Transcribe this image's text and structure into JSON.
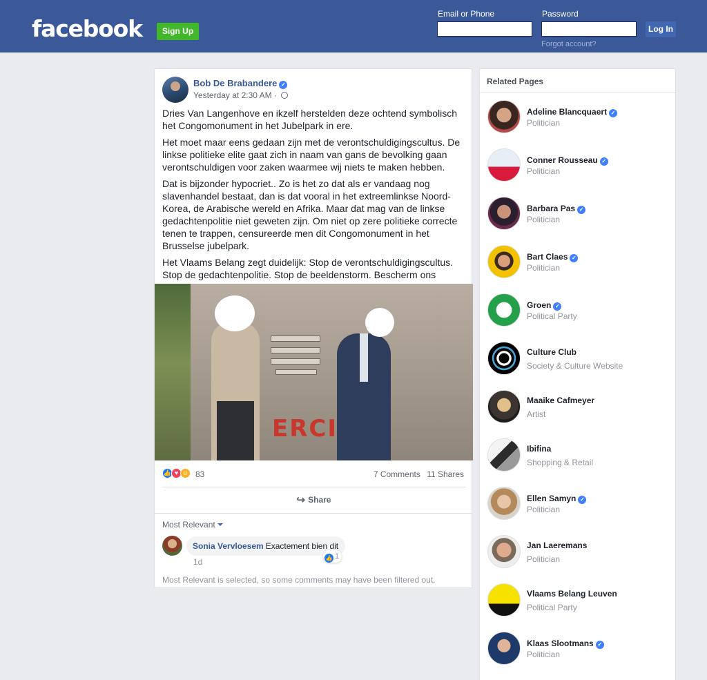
{
  "header": {
    "logo": "facebook",
    "signup_label": "Sign Up",
    "email_label": "Email or Phone",
    "password_label": "Password",
    "login_label": "Log In",
    "forgot_label": "Forgot account?",
    "brand_color": "#3b5998"
  },
  "post": {
    "author": "Bob De Brabandere",
    "timestamp": "Yesterday at 2:30 AM",
    "paragraphs": [
      "Dries Van Langenhove en ikzelf herstelden deze ochtend symbolisch het Congomonument in het Jubelpark in ere.",
      "Het moet maar eens gedaan zijn met de verontschuldigingscultus. De linkse politieke elite gaat zich in naam van gans de bevolking gaan verontschuldigen voor zaken waarmee wij niets te maken hebben.",
      "Dat is bijzonder hypocriet.. Zo is het zo dat als er vandaag nog slavenhandel bestaat, dan is dat vooral in het extreemlinkse Noord-Korea, de Arabische wereld en Afrika. Maar dat mag van de linkse gedachtenpolitie niet geweten zijn. Om niet op zere politieke correcte tenen te trappen, censureerde men dit Congomonument in het Brusselse jubelpark.",
      "Het Vlaams Belang zegt duidelijk: Stop de verontschuldigingscultus. Stop de gedachtenpolitie. Stop de beeldenstorm. Bescherm ons erfgoed!"
    ],
    "photo_graffiti": "ERCI",
    "reaction_count": "83",
    "comments_count": "7 Comments",
    "shares_count": "11 Shares",
    "share_label": "Share",
    "sort_label": "Most Relevant",
    "comment": {
      "author": "Sonia Vervloesem",
      "text": "Exactement bien dit",
      "likes": "1",
      "time": "1d"
    },
    "filter_note": "Most Relevant is selected, so some comments may have been filtered out."
  },
  "related": {
    "title": "Related Pages",
    "pages": [
      {
        "name": "Adeline Blancquaert",
        "category": "Politician",
        "verified": true
      },
      {
        "name": "Conner Rousseau",
        "category": "Politician",
        "verified": true
      },
      {
        "name": "Barbara Pas",
        "category": "Politician",
        "verified": true
      },
      {
        "name": "Bart Claes",
        "category": "Politician",
        "verified": true
      },
      {
        "name": "Groen",
        "category": "Political Party",
        "verified": true
      },
      {
        "name": "Culture Club",
        "category": "Society & Culture Website",
        "verified": false
      },
      {
        "name": "Maaike Cafmeyer",
        "category": "Artist",
        "verified": false
      },
      {
        "name": "Ibifina",
        "category": "Shopping & Retail",
        "verified": false
      },
      {
        "name": "Ellen Samyn",
        "category": "Politician",
        "verified": true
      },
      {
        "name": "Jan Laeremans",
        "category": "Politician",
        "verified": false
      },
      {
        "name": "Vlaams Belang Leuven",
        "category": "Political Party",
        "verified": false
      },
      {
        "name": "Klaas Slootmans",
        "category": "Politician",
        "verified": true
      }
    ]
  }
}
